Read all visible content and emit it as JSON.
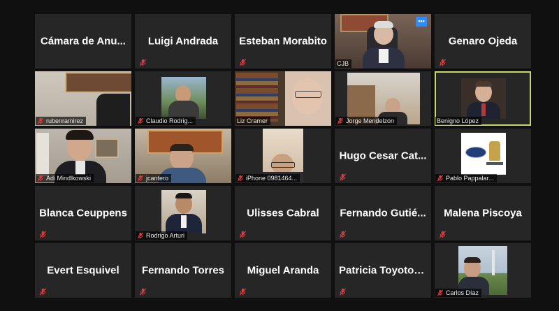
{
  "meeting": {
    "participants": [
      {
        "name": "Cámara de Anu...",
        "type": "name"
      },
      {
        "name": "Luigi Andrada",
        "type": "name"
      },
      {
        "name": "Esteban Morabito",
        "type": "name"
      },
      {
        "name": "CJB",
        "type": "video"
      },
      {
        "name": "Genaro Ojeda",
        "type": "name"
      },
      {
        "name": "rubenramirez",
        "type": "video"
      },
      {
        "name": "Claudio Rodrig...",
        "type": "video"
      },
      {
        "name": "Liz Cramer",
        "type": "video"
      },
      {
        "name": "Jorge Mendelzon",
        "type": "video"
      },
      {
        "name": "Benigno López",
        "type": "video",
        "active": true
      },
      {
        "name": "Adi Mindlkowski",
        "type": "video"
      },
      {
        "name": "jcantero",
        "type": "video"
      },
      {
        "name": "iPhone 0981464...",
        "type": "video"
      },
      {
        "name": "Hugo Cesar Cat...",
        "type": "name"
      },
      {
        "name": "Pablo Pappalar...",
        "type": "video"
      },
      {
        "name": "Blanca Ceuppens",
        "type": "name"
      },
      {
        "name": "Rodrigo Arturi",
        "type": "video"
      },
      {
        "name": "Ulisses Cabral",
        "type": "name"
      },
      {
        "name": "Fernando Gutié...",
        "type": "name"
      },
      {
        "name": "Malena Piscoya",
        "type": "name"
      },
      {
        "name": "Evert Esquivel",
        "type": "name"
      },
      {
        "name": "Fernando Torres",
        "type": "name"
      },
      {
        "name": "Miguel Aranda",
        "type": "name"
      },
      {
        "name": "Patricia Toyotoshi",
        "type": "name"
      },
      {
        "name": "Carlos Díaz",
        "type": "video"
      }
    ],
    "more_icon": "ellipsis-icon",
    "mute_icon": "microphone-muted-icon",
    "colors": {
      "background": "#101010",
      "tile": "#262626",
      "active_border": "#c8d66a",
      "mute_red": "#e0383e",
      "accent_blue": "#2d8cff"
    }
  }
}
